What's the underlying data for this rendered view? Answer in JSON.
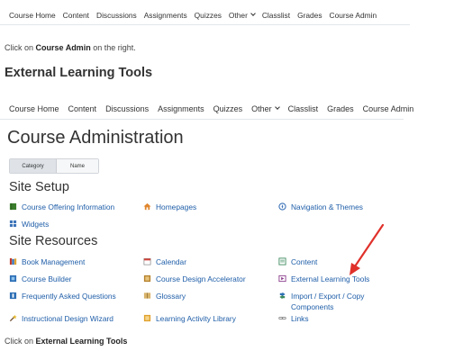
{
  "nav": {
    "items": [
      "Course Home",
      "Content",
      "Discussions",
      "Assignments",
      "Quizzes",
      "Other",
      "Classlist",
      "Grades",
      "Course Admin"
    ]
  },
  "instructions": {
    "step1_prefix": "Click on ",
    "step1_bold": "Course Admin",
    "step1_suffix": " on the right.",
    "step2_prefix": "Click on ",
    "step2_bold": "External Learning Tools"
  },
  "section_heading": "External Learning Tools",
  "panel": {
    "title": "Course Administration",
    "toggle": {
      "category": "Category",
      "name": "Name"
    },
    "site_setup": {
      "title": "Site Setup",
      "tools": [
        {
          "label": "Course Offering Information",
          "icon": "book-icon"
        },
        {
          "label": "Homepages",
          "icon": "home-icon"
        },
        {
          "label": "Navigation & Themes",
          "icon": "compass-icon"
        },
        {
          "label": "Widgets",
          "icon": "widgets-icon"
        }
      ]
    },
    "site_resources": {
      "title": "Site Resources",
      "tools": [
        {
          "label": "Book Management",
          "icon": "books-icon"
        },
        {
          "label": "Calendar",
          "icon": "calendar-icon"
        },
        {
          "label": "Content",
          "icon": "content-icon"
        },
        {
          "label": "Course Builder",
          "icon": "builder-icon"
        },
        {
          "label": "Course Design Accelerator",
          "icon": "accelerator-icon"
        },
        {
          "label": "External Learning Tools",
          "icon": "external-tools-icon"
        },
        {
          "label": "Frequently Asked Questions",
          "icon": "faq-icon"
        },
        {
          "label": "Glossary",
          "icon": "glossary-icon"
        },
        {
          "label": "Import / Export / Copy Components",
          "icon": "import-export-icon"
        },
        {
          "label": "Instructional Design Wizard",
          "icon": "wizard-icon"
        },
        {
          "label": "Learning Activity Library",
          "icon": "library-icon"
        },
        {
          "label": "Links",
          "icon": "links-icon"
        }
      ]
    }
  },
  "colors": {
    "link": "#1f5ea8",
    "annotation_arrow": "#e0312b"
  }
}
